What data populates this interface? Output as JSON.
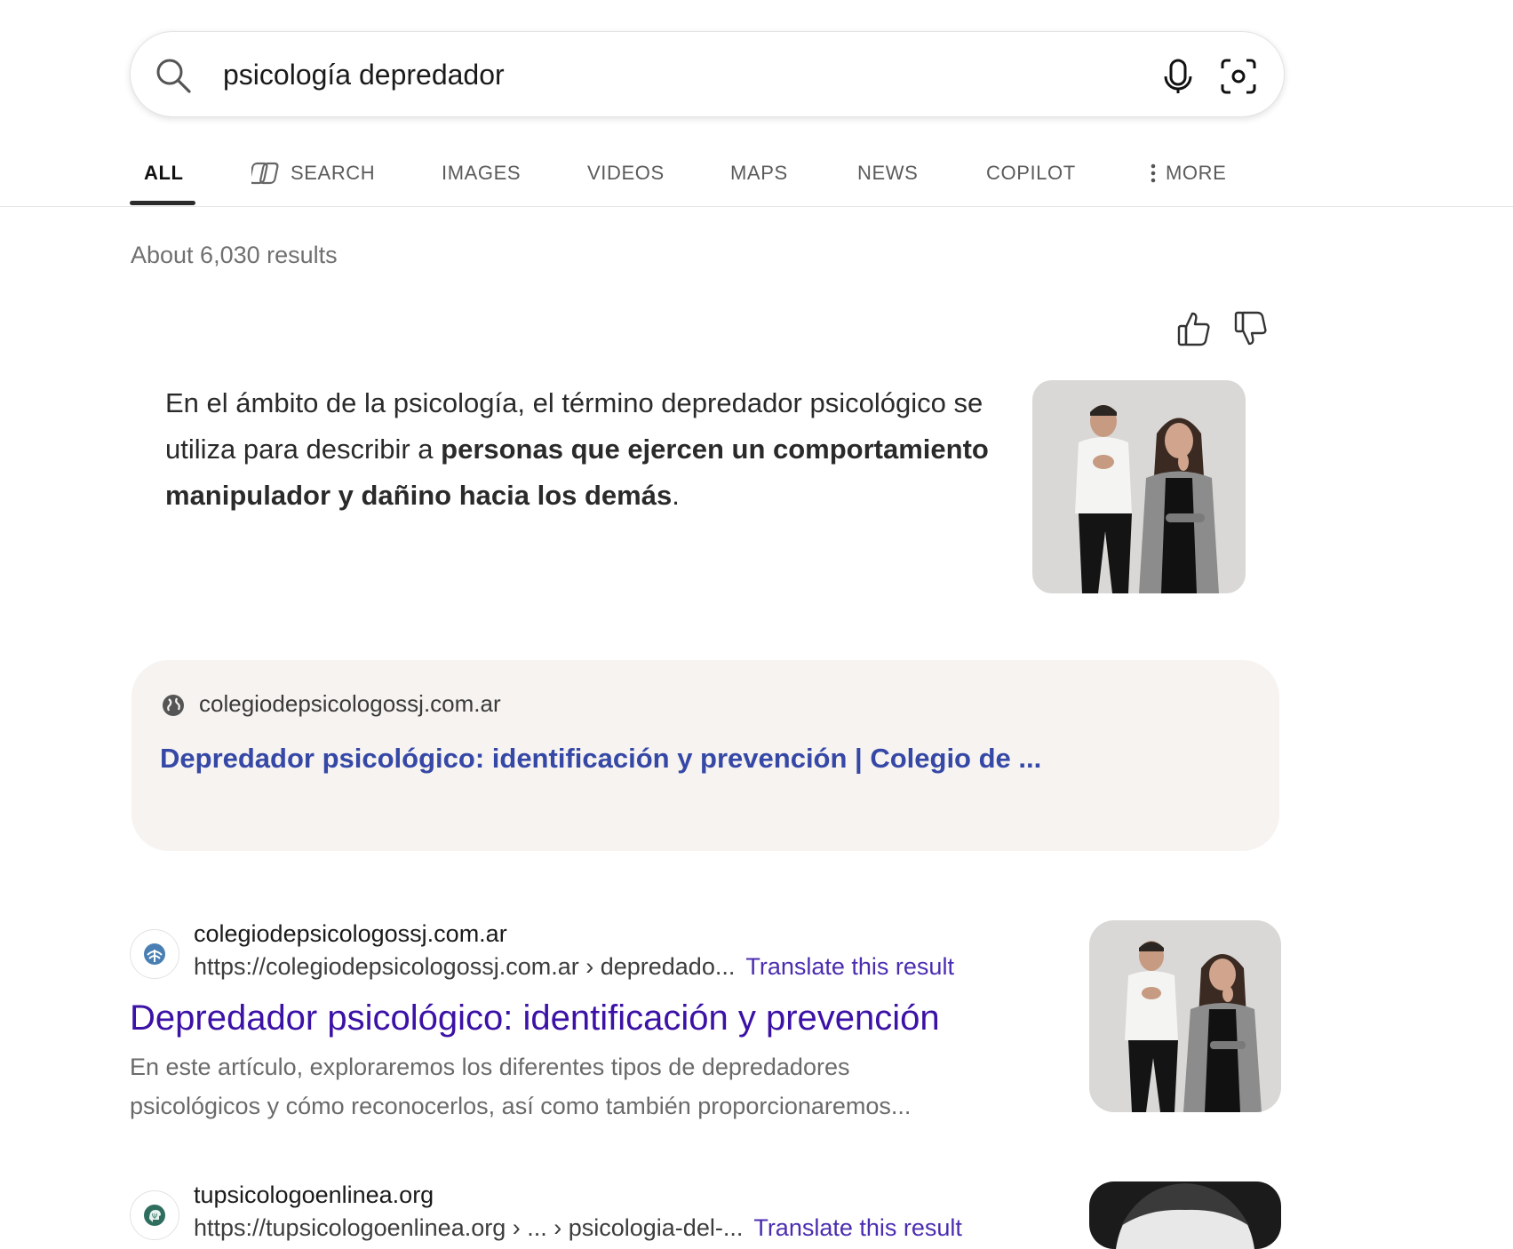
{
  "search": {
    "query": "psicología depredador"
  },
  "tabs": [
    {
      "label": "ALL"
    },
    {
      "label": "SEARCH"
    },
    {
      "label": "IMAGES"
    },
    {
      "label": "VIDEOS"
    },
    {
      "label": "MAPS"
    },
    {
      "label": "NEWS"
    },
    {
      "label": "COPILOT"
    },
    {
      "label": "MORE"
    }
  ],
  "result_count": "About 6,030 results",
  "answer": {
    "text_plain": "En el ámbito de la psicología, el término depredador psicológico se utiliza para describir a ",
    "text_bold": "personas que ejercen un comportamiento manipulador y dañino hacia los demás",
    "text_end": "."
  },
  "source_card": {
    "domain": "colegiodepsicologossj.com.ar",
    "title": "Depredador psicológico: identificación y prevención | Colegio de ..."
  },
  "results": [
    {
      "site": "colegiodepsicologossj.com.ar",
      "url": "https://colegiodepsicologossj.com.ar › depredado...",
      "translate": "Translate this result",
      "title": "Depredador psicológico: identificación y prevención",
      "snippet": "En este artículo, exploraremos los diferentes tipos de depredadores psicológicos y cómo reconocerlos, así como también proporcionaremos..."
    },
    {
      "site": "tupsicologoenlinea.org",
      "url": "https://tupsicologoenlinea.org › ... › psicologia-del-...",
      "translate": "Translate this result"
    }
  ],
  "colors": {
    "link_title": "#3b11a6",
    "card_title": "#3648a6",
    "translate": "#4b2db0",
    "card_bg": "#f6f3f1"
  }
}
